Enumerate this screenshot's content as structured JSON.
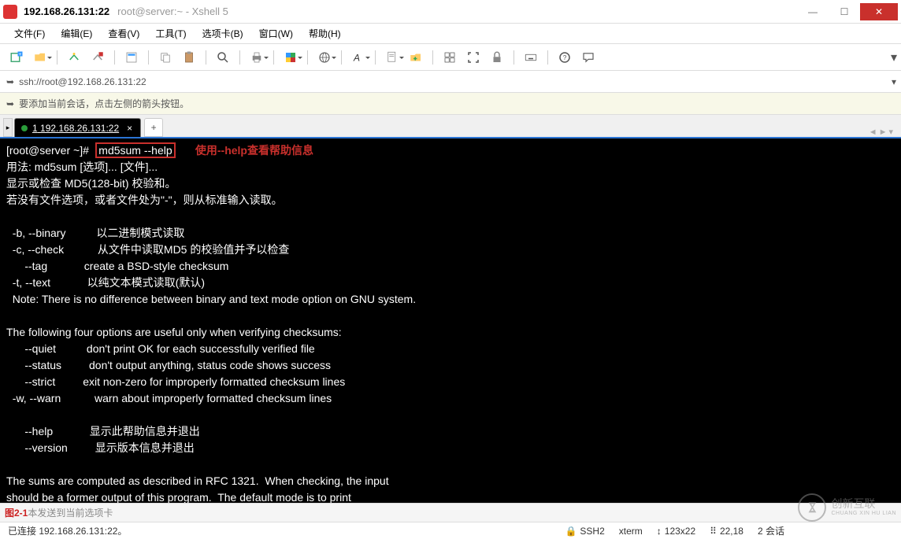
{
  "window": {
    "host": "192.168.26.131:22",
    "title": "root@server:~ - Xshell 5"
  },
  "menu": {
    "file": "文件(F)",
    "edit": "编辑(E)",
    "view": "查看(V)",
    "tools": "工具(T)",
    "tab": "选项卡(B)",
    "window": "窗口(W)",
    "help": "帮助(H)"
  },
  "address": {
    "url": "ssh://root@192.168.26.131:22"
  },
  "infobar": {
    "text": "要添加当前会话，点击左侧的箭头按钮。"
  },
  "tabs": {
    "active": {
      "index": "1",
      "label": "192.168.26.131:22"
    }
  },
  "terminal": {
    "prompt_user": "[root@server ~]#",
    "command": "md5sum --help",
    "annotation": "使用--help查看帮助信息",
    "lines": [
      "用法: md5sum [选项]... [文件]...",
      "显示或检查 MD5(128-bit) 校验和。",
      "若没有文件选项，或者文件处为\"-\"，则从标准输入读取。",
      "",
      "  -b, --binary          以二进制模式读取",
      "  -c, --check           从文件中读取MD5 的校验值并予以检查",
      "      --tag            create a BSD-style checksum",
      "  -t, --text            以纯文本模式读取(默认)",
      "  Note: There is no difference between binary and text mode option on GNU system.",
      "",
      "The following four options are useful only when verifying checksums:",
      "      --quiet          don't print OK for each successfully verified file",
      "      --status         don't output anything, status code shows success",
      "      --strict         exit non-zero for improperly formatted checksum lines",
      "  -w, --warn           warn about improperly formatted checksum lines",
      "",
      "      --help            显示此帮助信息并退出",
      "      --version         显示版本信息并退出",
      "",
      "The sums are computed as described in RFC 1321.  When checking, the input",
      "should be a former output of this program.  The default mode is to print"
    ]
  },
  "input_tabs": {
    "figure_label": "图2-1",
    "hint": "本发送到当前选项卡"
  },
  "status": {
    "connection": "已连接 192.168.26.131:22。",
    "protocol": "SSH2",
    "termtype": "xterm",
    "size": "123x22",
    "cursor": "22,18",
    "sessions": "2 会话"
  },
  "watermark": {
    "brand_cn": "创新互联",
    "brand_py": "CHUANG XIN HU LIAN"
  },
  "icons": {
    "lock": "🔒",
    "arrow": "↕",
    "dot": "⠿"
  }
}
